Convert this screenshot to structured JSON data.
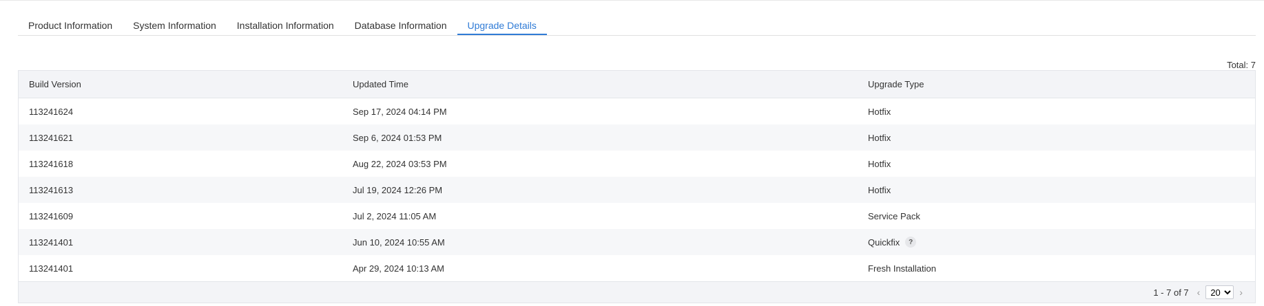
{
  "tabs": [
    {
      "label": "Product Information",
      "active": false
    },
    {
      "label": "System Information",
      "active": false
    },
    {
      "label": "Installation Information",
      "active": false
    },
    {
      "label": "Database Information",
      "active": false
    },
    {
      "label": "Upgrade Details",
      "active": true
    }
  ],
  "total_label": "Total: 7",
  "table": {
    "columns": [
      "Build Version",
      "Updated Time",
      "Upgrade Type"
    ],
    "rows": [
      {
        "build": "113241624",
        "time": "Sep 17, 2024 04:14 PM",
        "type": "Hotfix"
      },
      {
        "build": "113241621",
        "time": "Sep 6, 2024 01:53 PM",
        "type": "Hotfix"
      },
      {
        "build": "113241618",
        "time": "Aug 22, 2024 03:53 PM",
        "type": "Hotfix"
      },
      {
        "build": "113241613",
        "time": "Jul 19, 2024 12:26 PM",
        "type": "Hotfix"
      },
      {
        "build": "113241609",
        "time": "Jul 2, 2024 11:05 AM",
        "type": "Service Pack"
      },
      {
        "build": "113241401",
        "time": "Jun 10, 2024 10:55 AM",
        "type": "Quickfix",
        "help_icon": "?"
      },
      {
        "build": "113241401",
        "time": "Apr 29, 2024 10:13 AM",
        "type": "Fresh Installation"
      }
    ]
  },
  "pagination": {
    "range": "1 - 7 of 7",
    "prev_icon": "chevron-left-icon",
    "next_icon": "chevron-right-icon",
    "page_size": "20",
    "page_size_options": [
      "20"
    ]
  },
  "colors": {
    "accent": "#2f7bd6",
    "header_bg": "#f3f4f7",
    "alt_row_bg": "#f6f7f9"
  }
}
